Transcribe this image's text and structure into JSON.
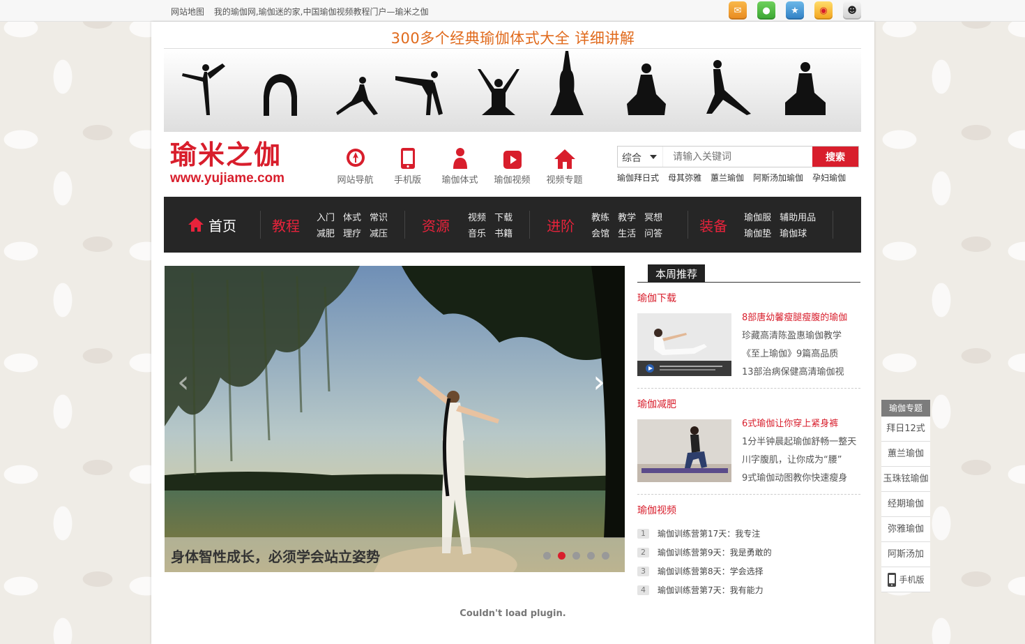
{
  "topbar": {
    "sitemap": "网站地图",
    "tagline": "我的瑜伽网,瑜伽迷的家,中国瑜伽视频教程门户—瑜米之伽",
    "social": [
      "mail-icon",
      "wechat-icon",
      "qq-zone-icon",
      "weibo-icon",
      "qq-icon"
    ]
  },
  "banner": {
    "title": "300多个经典瑜伽体式大全 详细讲解"
  },
  "logo": {
    "cn": "瑜米之伽",
    "en": "www.yujiame.com"
  },
  "quick_nav": [
    {
      "label": "网站导航",
      "icon": "compass-icon"
    },
    {
      "label": "手机版",
      "icon": "mobile-icon"
    },
    {
      "label": "瑜伽体式",
      "icon": "person-icon"
    },
    {
      "label": "瑜伽视频",
      "icon": "video-icon"
    },
    {
      "label": "视频专题",
      "icon": "home-icon"
    }
  ],
  "search": {
    "category": "综合",
    "placeholder": "请输入关键词",
    "button": "搜索",
    "hot": [
      "瑜伽拜日式",
      "母其弥雅",
      "蕙兰瑜伽",
      "阿斯汤加瑜伽",
      "孕妇瑜伽"
    ]
  },
  "nav": {
    "home": "首页",
    "groups": [
      {
        "title": "教程",
        "links": [
          "入门",
          "体式",
          "常识",
          "减肥",
          "理疗",
          "减压"
        ]
      },
      {
        "title": "资源",
        "links": [
          "视频",
          "下载",
          "音乐",
          "书籍"
        ]
      },
      {
        "title": "进阶",
        "links": [
          "教练",
          "教学",
          "冥想",
          "会馆",
          "生活",
          "问答"
        ]
      },
      {
        "title": "装备",
        "links": [
          "瑜伽服",
          "辅助用品",
          "瑜伽垫",
          "瑜伽球"
        ]
      }
    ]
  },
  "slider": {
    "caption": "身体智性成长，必须学会站立姿势",
    "slide_count": 5,
    "active_index": 1,
    "prev": "‹",
    "next": "›"
  },
  "weekly": {
    "title": "本周推荐",
    "sections": [
      {
        "title": "瑜伽下载",
        "items": [
          "8部唐幼馨瘦腿瘦腹的瑜伽",
          "珍藏高清陈盈惠瑜伽教学",
          "《至上瑜伽》9篇高品质",
          "13部治病保健高清瑜伽视"
        ]
      },
      {
        "title": "瑜伽减肥",
        "items": [
          "6式瑜伽让你穿上紧身裤",
          "1分半钟晨起瑜伽舒畅一整天",
          "川字腹肌，让你成为“腰”",
          "9式瑜伽动图教你快速瘦身"
        ]
      }
    ],
    "video_title": "瑜伽视频",
    "videos": [
      {
        "num": "1",
        "text": "瑜伽训练营第17天：我专注"
      },
      {
        "num": "2",
        "text": "瑜伽训练营第9天：我是勇敢的"
      },
      {
        "num": "3",
        "text": "瑜伽训练营第8天：学会选择"
      },
      {
        "num": "4",
        "text": "瑜伽训练营第7天：我有能力"
      }
    ]
  },
  "plugin_message": "Couldn't load plugin.",
  "float_menu": {
    "title": "瑜伽专题",
    "items": [
      "拜日12式",
      "蕙兰瑜伽",
      "玉珠铉瑜伽",
      "经期瑜伽",
      "弥雅瑜伽",
      "阿斯汤加"
    ],
    "phone": "手机版"
  },
  "colors": {
    "accent": "#d81e2c",
    "nav_bg": "#262626",
    "banner_title": "#e06a1c"
  }
}
